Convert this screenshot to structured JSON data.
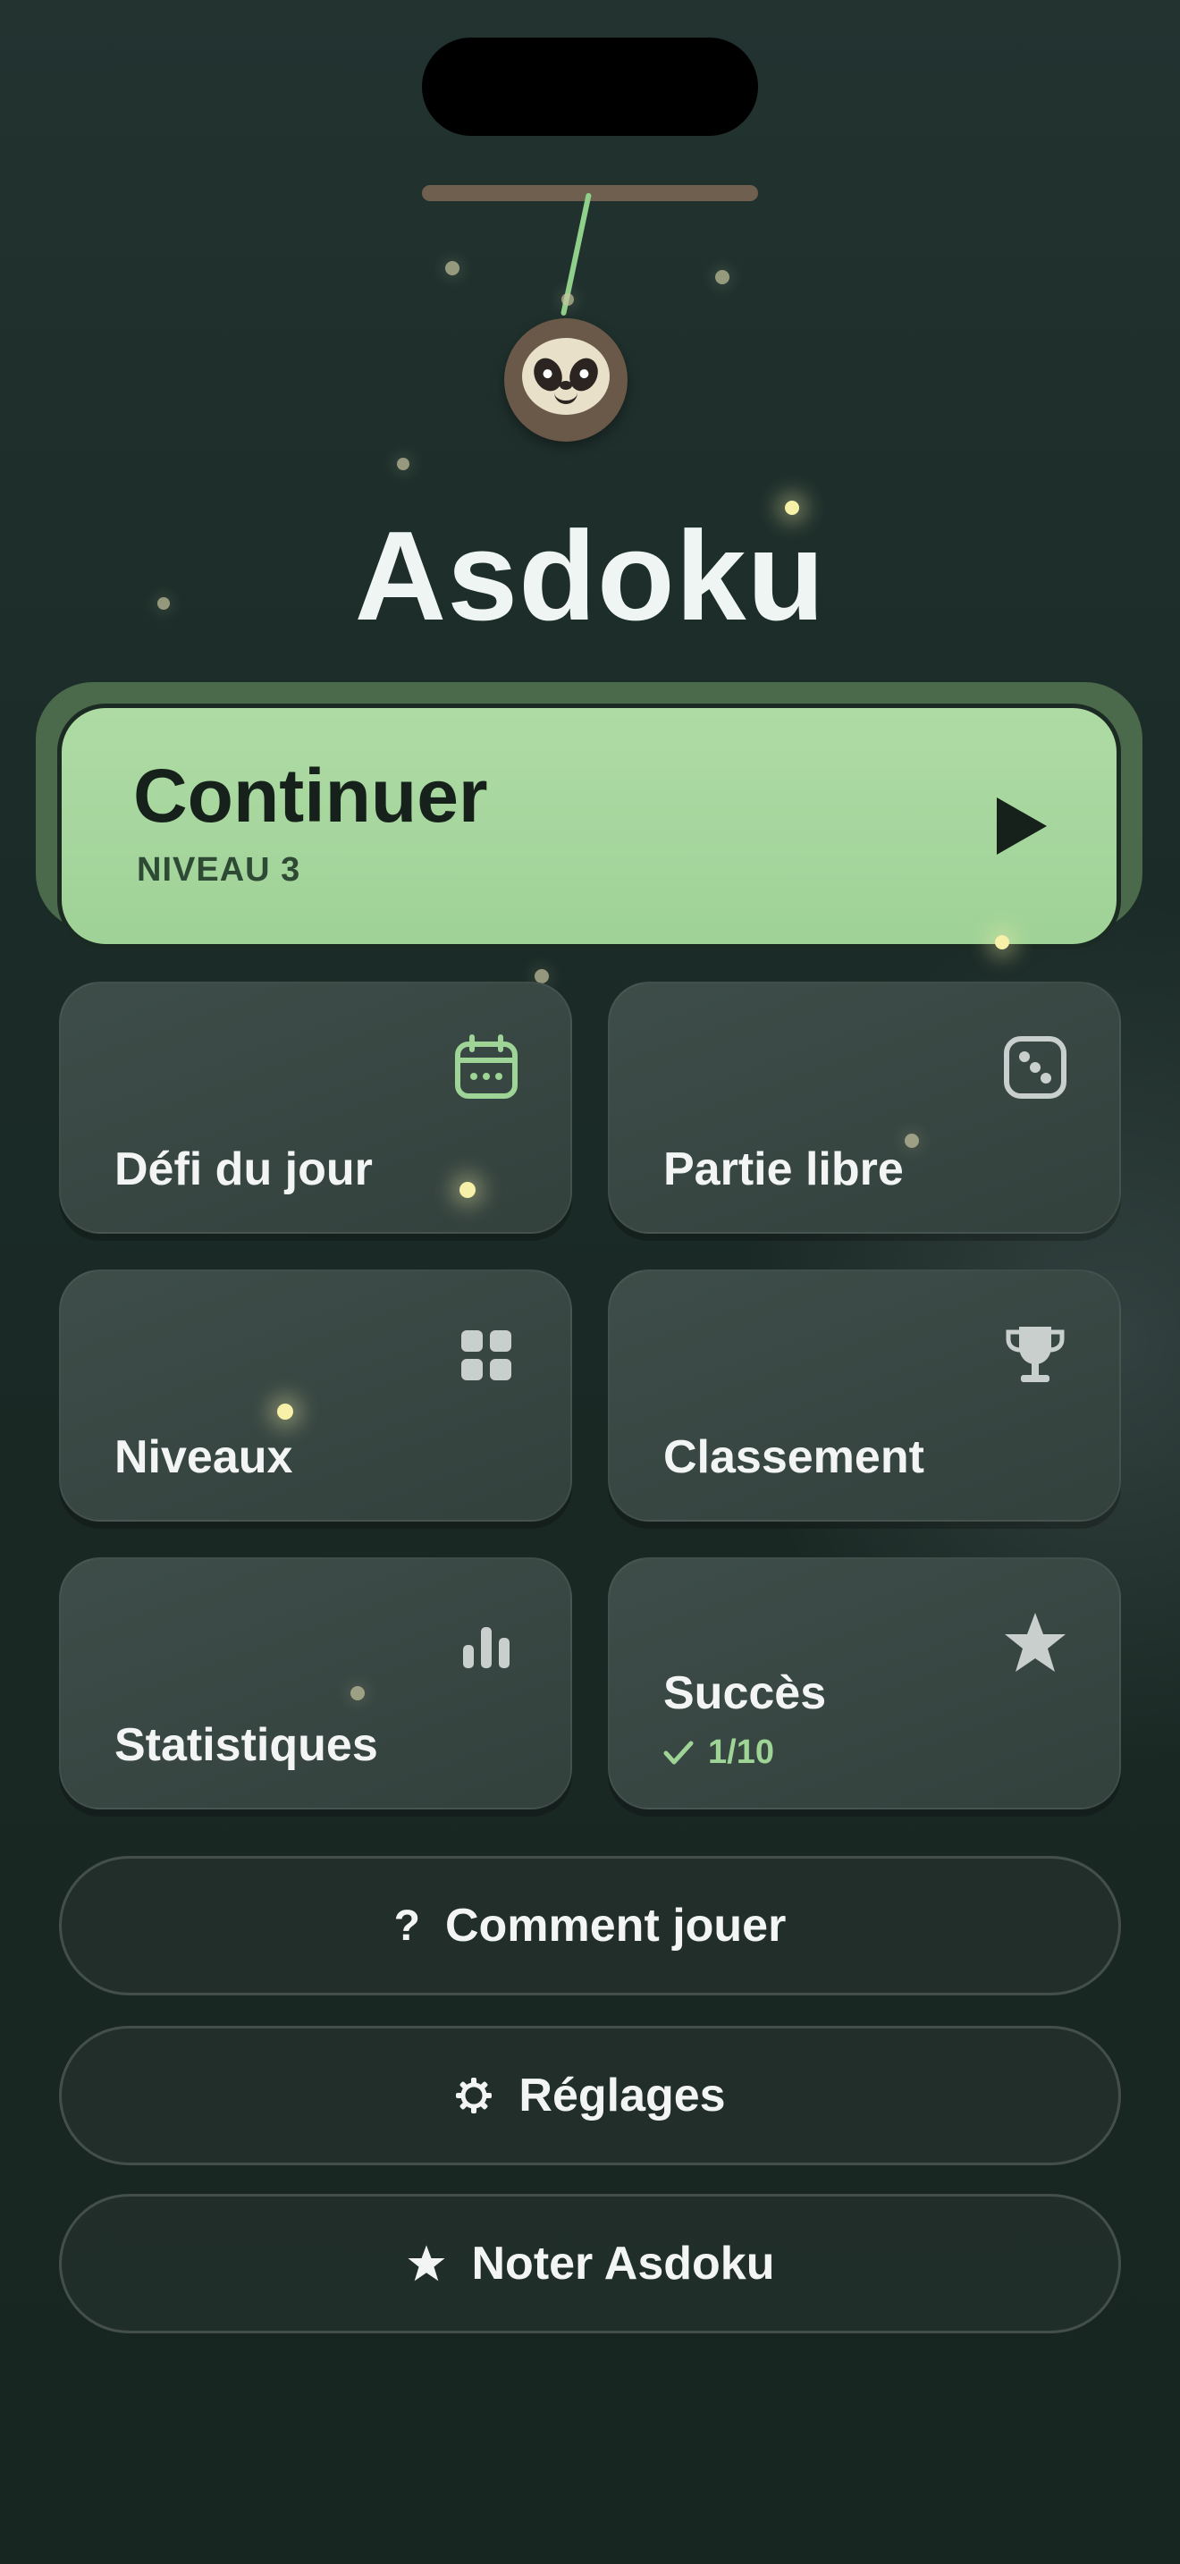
{
  "app": {
    "title": "Asdoku"
  },
  "continue": {
    "label": "Continuer",
    "sublabel": "NIVEAU 3",
    "icon": "play-icon"
  },
  "tiles": [
    {
      "label": "Défi du jour",
      "icon": "calendar-icon"
    },
    {
      "label": "Partie libre",
      "icon": "dice-icon"
    },
    {
      "label": "Niveaux",
      "icon": "grid-icon"
    },
    {
      "label": "Classement",
      "icon": "trophy-icon"
    },
    {
      "label": "Statistiques",
      "icon": "bar-chart-icon"
    },
    {
      "label": "Succès",
      "icon": "star-icon",
      "progress": "1/10"
    }
  ],
  "actions": [
    {
      "label": "Comment jouer",
      "icon": "question-icon"
    },
    {
      "label": "Réglages",
      "icon": "gear-icon"
    },
    {
      "label": "Noter Asdoku",
      "icon": "star-icon"
    }
  ],
  "colors": {
    "accent": "#a8d89f",
    "background": "#1d2d29",
    "card": "#3a4845",
    "text": "#f2f5f4"
  }
}
